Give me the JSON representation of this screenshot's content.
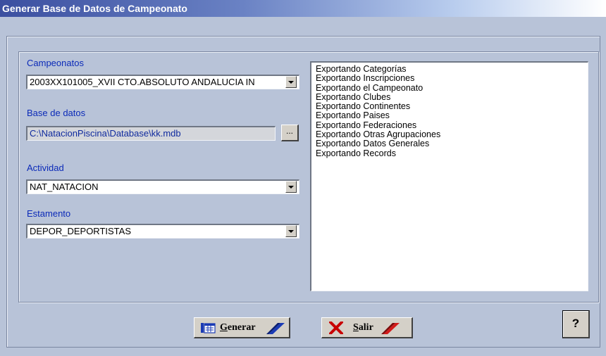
{
  "window": {
    "title": "Generar Base de Datos de Campeonato"
  },
  "form": {
    "campeonatos": {
      "label": "Campeonatos",
      "value": "2003XX101005_XVII CTO.ABSOLUTO ANDALUCIA IN"
    },
    "base_datos": {
      "label": "Base de datos",
      "value": "C:\\NatacionPiscina\\Database\\kk.mdb",
      "browse_label": "..."
    },
    "actividad": {
      "label": "Actividad",
      "value": "NAT_NATACION"
    },
    "estamento": {
      "label": "Estamento",
      "value": "DEPOR_DEPORTISTAS"
    }
  },
  "log": {
    "lines": [
      "Exportando Categorías",
      "Exportando Inscripciones",
      "Exportando el Campeonato",
      "Exportando Clubes",
      "Exportando Continentes",
      "Exportando Paises",
      "Exportando Federaciones",
      "Exportando Otras Agrupaciones",
      "Exportando Datos Generales",
      "Exportando Records"
    ]
  },
  "buttons": {
    "generar": {
      "hotkey": "G",
      "rest": "enerar"
    },
    "salir": {
      "hotkey": "S",
      "rest": "alir"
    },
    "help": "?"
  },
  "colors": {
    "label": "#0b2ab8",
    "background": "#b8c3d8",
    "title_start": "#3b4fa0",
    "salir_icon": "#c80000",
    "generar_slash": "#1b3bb5",
    "salir_slash": "#d21a1a"
  }
}
